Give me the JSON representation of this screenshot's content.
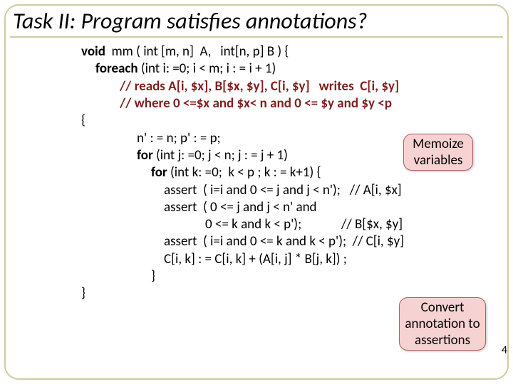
{
  "title": "Task II: Program satisfies annotations?",
  "code": {
    "l1_a": "void",
    "l1_b": "  mm ( int [m, n]  A,   int[n, p] B ) {",
    "l2_a": "foreach",
    "l2_b": " (int i: =0; i < m; i : = i + 1)",
    "l3": "// reads A[i, $x], B[$x, $y], C[i, $y]   writes  C[i, $y]",
    "l4": "// where 0 <=$x and $x< n and 0 <= $y and $y <p",
    "l5": "{",
    "l6": "n' : = n; p' : = p;",
    "l7_a": "for",
    "l7_b": " (int j: =0; j < n; j : = j + 1)",
    "l8_a": "for",
    "l8_b": " (int k: =0;  k < p ; k : = k+1) {",
    "l9": "assert  ( i=i and 0 <= j and j < n');   // A[i, $x]",
    "l10": "assert  ( 0 <= j and j < n' and",
    "l11_a": "0 <= k and k < p');",
    "l11_b": "             // B[$x, $y]",
    "l12": "assert  ( i=i and 0 <= k and k < p');  // C[i, $y]",
    "l13": "C[i, k] : = C[i, k] + (A[i, j] * B[j, k]) ;",
    "l14": "}",
    "l15": "}"
  },
  "bubble1": "Memoize variables",
  "bubble2": "Convert annotation to assertions",
  "pagenum": "4"
}
